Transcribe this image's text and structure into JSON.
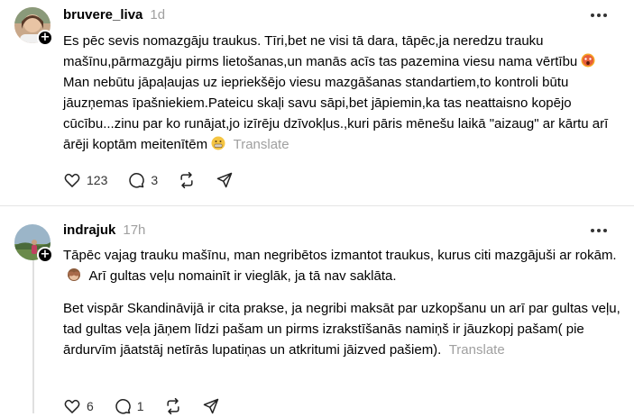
{
  "posts": [
    {
      "username": "bruvere_liva",
      "time": "1d",
      "text_1": "Es pēc sevis nomazgāju traukus. Tīri,bet ne visi tā dara, tāpēc,ja neredzu trauku mašīnu,pārmazgāju pirms lietošanas,un manās acīs tas pazemina viesu nama vērtību",
      "text_2": "Man nebūtu jāpaļaujas uz iepriekšējo viesu mazgāšanas standartiem,to kontroli būtu jāuzņemas īpašniekiem.Pateicu skaļi savu sāpi,bet jāpiemin,ka tas neattaisno kopējo cūcību...zinu par ko runājat,jo izīrēju dzīvokļus.,kuri pāris mēnešu laikā \"aizaug\" ar kārtu arī ārēji koptām meitenītēm",
      "translate": "Translate",
      "likes": "123",
      "replies": "3"
    },
    {
      "username": "indrajuk",
      "time": "17h",
      "para_1a": "Tāpēc vajag trauku mašīnu, man negribētos izmantot traukus, kurus citi mazgājuši ar rokām.",
      "para_1b": "Arī gultas veļu nomainīt ir vieglāk, ja tā nav saklāta.",
      "para_2": "Bet vispār Skandināvijā ir cita prakse, ja negribi maksāt par uzkopšanu un arī par gultas veļu, tad gultas veļa jāņem līdzi pašam un pirms izrakstīšanās namiņš ir jāuzkopj pašam( pie ārdurvīm jāatstāj netīrās lupatiņas un atkritumi jāizved pašiem).",
      "translate": "Translate",
      "likes": "6",
      "replies": "1"
    }
  ],
  "icons": [
    "heart-icon",
    "comment-icon",
    "repost-icon",
    "share-icon",
    "more-icon",
    "follow-plus-icon"
  ]
}
